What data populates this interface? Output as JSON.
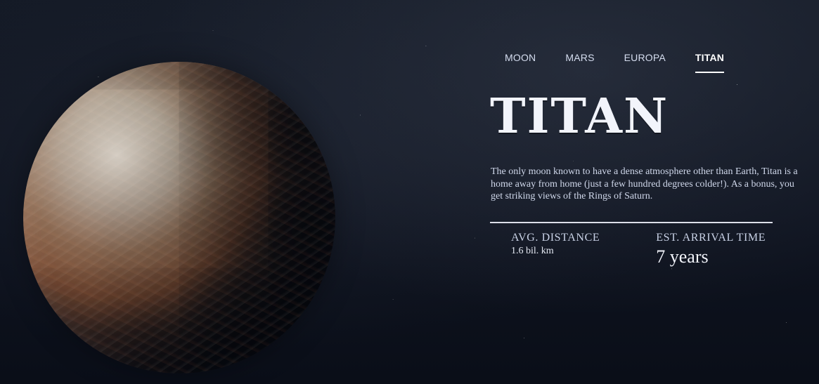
{
  "nav": {
    "items": [
      {
        "label": "MOON",
        "active": false
      },
      {
        "label": "MARS",
        "active": false
      },
      {
        "label": "EUROPA",
        "active": false
      },
      {
        "label": "TITAN",
        "active": true
      }
    ]
  },
  "destination": {
    "name": "TITAN",
    "description": "The only moon known to have a dense atmosphere other than Earth, Titan is a home away from home (just a few hundred degrees colder!). As a bonus, you get striking views of the Rings of Saturn.",
    "stats": {
      "distance": {
        "label": "AVG. DISTANCE",
        "value": "1.6 bil. km"
      },
      "arrival": {
        "label": "EST. ARRIVAL TIME",
        "value": "7 years"
      }
    }
  },
  "colors": {
    "background": "#0b0f1a",
    "text_primary": "#f2f4fb",
    "text_secondary": "#cfd7ea",
    "accent_underline": "#ffffff"
  },
  "icons": {
    "planet": "planet-icon"
  }
}
